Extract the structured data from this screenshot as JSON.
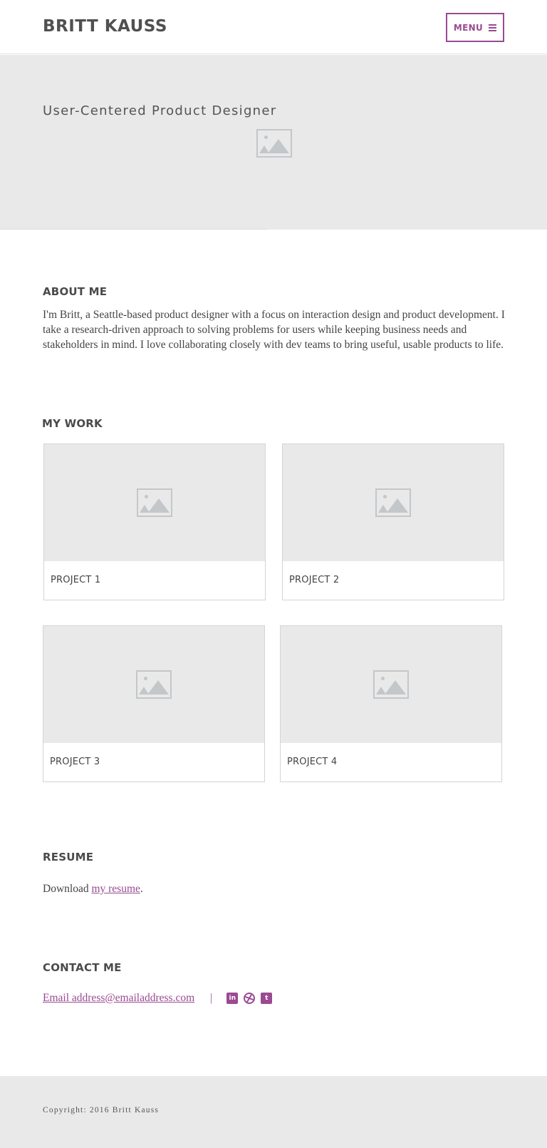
{
  "header": {
    "site_title": "BRITT KAUSS",
    "menu_label": "MENU",
    "menu_icon": "hamburger-icon"
  },
  "hero": {
    "tagline": "User-Centered Product Designer",
    "image_icon": "image-placeholder-icon"
  },
  "about": {
    "heading": "ABOUT ME",
    "text": "I'm Britt, a Seattle-based product designer with a focus on interaction design and product development. I take a research-driven approach to solving problems for users while keeping business needs and stakeholders in mind. I love collaborating closely with dev teams to bring useful, usable products to life."
  },
  "work": {
    "heading": "MY WORK",
    "projects": [
      {
        "label": "PROJECT 1"
      },
      {
        "label": "PROJECT 2"
      },
      {
        "label": "PROJECT 3"
      },
      {
        "label": "PROJECT 4"
      }
    ]
  },
  "resume": {
    "heading": "RESUME",
    "prefix": "Download ",
    "link_text": "my resume",
    "suffix": "."
  },
  "contact": {
    "heading": "CONTACT ME",
    "email_text": "Email address@emailaddress.com",
    "separator": "|",
    "social": [
      {
        "icon": "linkedin-icon",
        "glyph": "in"
      },
      {
        "icon": "dribbble-icon",
        "glyph": ""
      },
      {
        "icon": "twitter-icon",
        "glyph": "t"
      }
    ]
  },
  "footer": {
    "copyright": "Copyright: 2016 Britt Kauss"
  },
  "colors": {
    "accent": "#9a4a92",
    "placeholder_bg": "#e9e9e9",
    "heading_text": "#4a4a4a"
  }
}
